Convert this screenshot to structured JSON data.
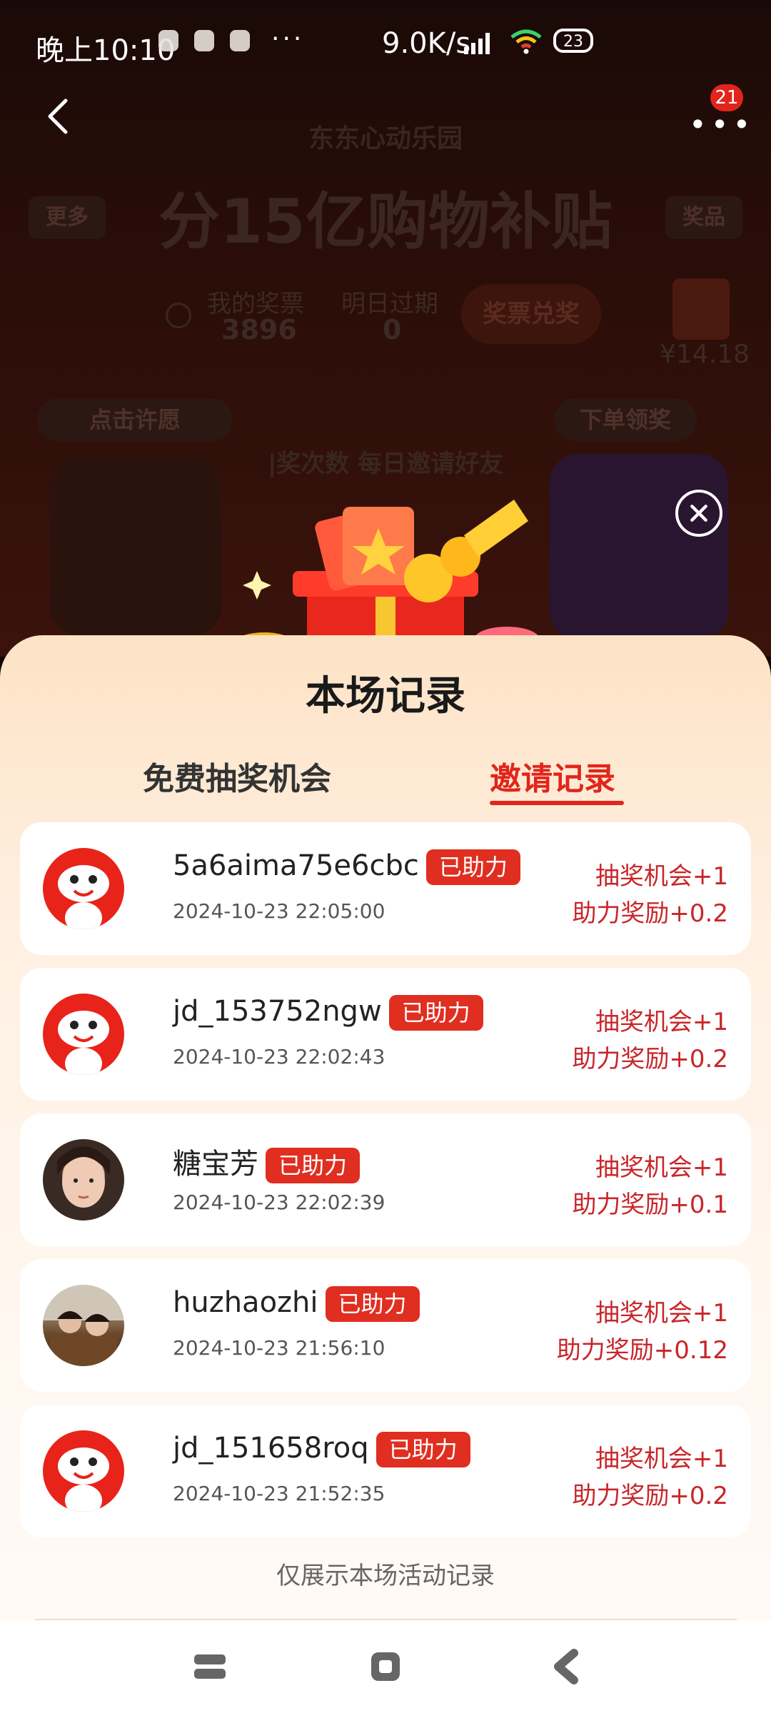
{
  "status_bar": {
    "time": "晚上10:10",
    "dots": "···",
    "speed": "9.0K/s",
    "battery": "23"
  },
  "nav": {
    "badge": "21"
  },
  "background": {
    "subtitle": "东东心动乐园",
    "title": "分15亿购物补贴",
    "left_button": "更多",
    "right_button": "奖品",
    "tickets_label": "我的奖票",
    "tickets_value": "3896",
    "expire_label": "明日过期",
    "expire_value": "0",
    "redeem_button": "奖票兑奖",
    "prize_price": "¥14.18",
    "wish_button": "点击许愿",
    "order_button": "下单领奖",
    "marquee": "|奖次数 每日邀请好友"
  },
  "sheet": {
    "title": "本场记录",
    "tabs": [
      {
        "label": "免费抽奖机会",
        "active": false
      },
      {
        "label": "邀请记录",
        "active": true
      }
    ],
    "records": [
      {
        "avatar": "jd-mascot",
        "name": "5a6aima75e6cbc",
        "badge": "已助力",
        "time": "2024-10-23 22:05:00",
        "reward1": "抽奖机会+1",
        "reward2": "助力奖励+0.2"
      },
      {
        "avatar": "jd-mascot",
        "name": "jd_153752ngw",
        "badge": "已助力",
        "time": "2024-10-23 22:02:43",
        "reward1": "抽奖机会+1",
        "reward2": "助力奖励+0.2"
      },
      {
        "avatar": "photo-girl",
        "name": "糖宝芳",
        "badge": "已助力",
        "time": "2024-10-23 22:02:39",
        "reward1": "抽奖机会+1",
        "reward2": "助力奖励+0.1"
      },
      {
        "avatar": "photo-two",
        "name": "huzhaozhi",
        "badge": "已助力",
        "time": "2024-10-23 21:56:10",
        "reward1": "抽奖机会+1",
        "reward2": "助力奖励+0.12"
      },
      {
        "avatar": "jd-mascot",
        "name": "jd_151658roq",
        "badge": "已助力",
        "time": "2024-10-23 21:52:35",
        "reward1": "抽奖机会+1",
        "reward2": "助力奖励+0.2"
      }
    ],
    "footer_note": "仅展示本场活动记录"
  },
  "colors": {
    "accent": "#e1251b",
    "reward_text": "#c8262a",
    "sheet_top": "#fde3c6"
  }
}
